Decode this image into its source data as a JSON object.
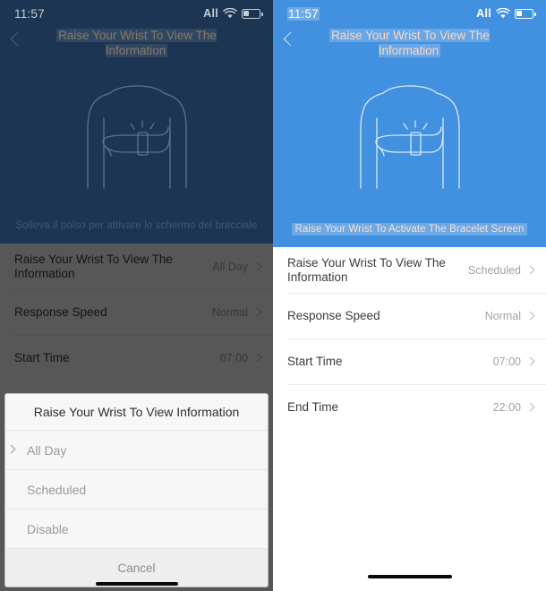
{
  "left": {
    "status": {
      "time": "11:57",
      "carrier": "All",
      "wifi_icon": "wifi-icon",
      "battery_icon": "battery-icon"
    },
    "nav": {
      "back_icon": "back-chevron-icon",
      "title": "Raise Your Wrist To View The Information"
    },
    "hero": {
      "illustration": "raise-wrist-illustration",
      "caption": "Solleva il polso per attivare lo schermo del bracciale",
      "bg_color": "#1c3552"
    },
    "rows": [
      {
        "label": "Raise Your Wrist To View The Information",
        "value": "All Day",
        "chevron": "chevron-right-icon"
      },
      {
        "label": "Response Speed",
        "value": "Normal",
        "chevron": "chevron-right-icon"
      },
      {
        "label": "Start Time",
        "value": "07:00",
        "chevron": "chevron-right-icon"
      }
    ],
    "sheet": {
      "title": "Raise Your Wrist To View Information",
      "options": [
        {
          "label": "All Day",
          "selected": true
        },
        {
          "label": "Scheduled",
          "selected": false
        },
        {
          "label": "Disable",
          "selected": false
        }
      ],
      "cancel_label": "Cancel"
    }
  },
  "right": {
    "status": {
      "time": "11:57",
      "carrier": "All",
      "wifi_icon": "wifi-icon",
      "battery_icon": "battery-icon"
    },
    "nav": {
      "back_icon": "back-chevron-icon",
      "title": "Raise Your Wrist To View The Information"
    },
    "hero": {
      "illustration": "raise-wrist-illustration",
      "caption": "Raise Your Wrist To Activate The Bracelet Screen",
      "bg_color": "#4291e1"
    },
    "rows": [
      {
        "label": "Raise Your Wrist To View The Information",
        "value": "Scheduled",
        "chevron": "chevron-right-icon"
      },
      {
        "label": "Response Speed",
        "value": "Normal",
        "chevron": "chevron-right-icon"
      },
      {
        "label": "Start Time",
        "value": "07:00",
        "chevron": "chevron-right-icon"
      },
      {
        "label": "End Time",
        "value": "22:00",
        "chevron": "chevron-right-icon"
      }
    ]
  }
}
